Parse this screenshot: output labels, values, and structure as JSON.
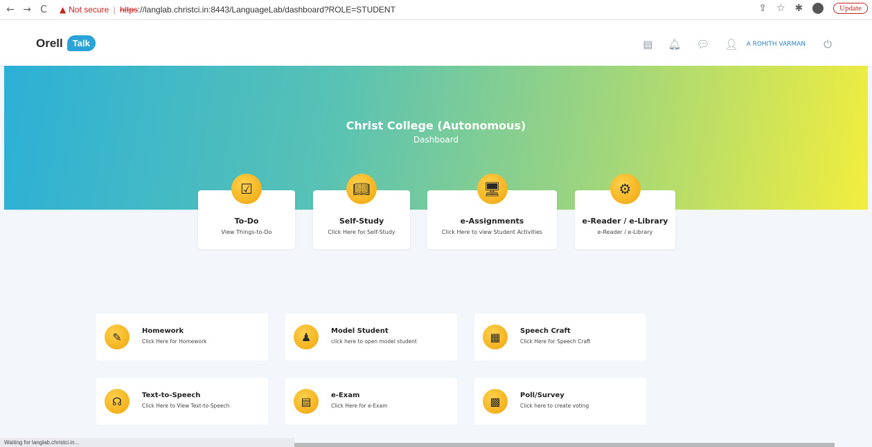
{
  "browser": {
    "back_icon": "←",
    "forward_icon": "→",
    "reload_icon": "C",
    "warning_icon": "▲",
    "not_secure": "Not secure",
    "url_protocol": "https",
    "url_rest": "://langlab.christci.in:8443/LanguageLab/dashboard?ROLE=STUDENT",
    "update_label": "Update"
  },
  "header": {
    "logo_orell": "Orell",
    "logo_talk": "Talk",
    "user_name": "A ROHITH VARMAN"
  },
  "banner": {
    "title": "Christ College (Autonomous)",
    "subtitle": "Dashboard"
  },
  "top_cards": [
    {
      "title": "To-Do",
      "subtitle": "View Things-to-Do",
      "icon": "checklist-icon"
    },
    {
      "title": "Self-Study",
      "subtitle": "Click Here for Self-Study",
      "icon": "reading-student-icon"
    },
    {
      "title": "e-Assignments",
      "subtitle": "Click Here to view Student Activities",
      "icon": "computer-screen-icon"
    },
    {
      "title": "e-Reader / e-Library",
      "subtitle": "e-Reader / e-Library",
      "icon": "ebook-reader-icon"
    }
  ],
  "features": [
    {
      "title": "Homework",
      "subtitle": "Click Here for Homework",
      "icon": "homework-icon"
    },
    {
      "title": "Model Student",
      "subtitle": "click here to open model student",
      "icon": "model-student-icon"
    },
    {
      "title": "Speech Craft",
      "subtitle": "Click Here for Speech Craft",
      "icon": "speech-craft-icon"
    },
    {
      "title": "Text-to-Speech",
      "subtitle": "Click Here to View Text-to-Speech",
      "icon": "text-to-speech-icon"
    },
    {
      "title": "e-Exam",
      "subtitle": "Click Here for e-Exam",
      "icon": "exam-icon"
    },
    {
      "title": "Poll/Survey",
      "subtitle": "Click here to create voting",
      "icon": "poll-icon"
    }
  ],
  "status": {
    "text": "Waiting for langlab.christci.in..."
  },
  "colors": {
    "accent": "#2aa3d8",
    "icon_gold": "#f0a30a",
    "banner_start": "#2cb0d7",
    "banner_end": "#f2ee3d"
  }
}
